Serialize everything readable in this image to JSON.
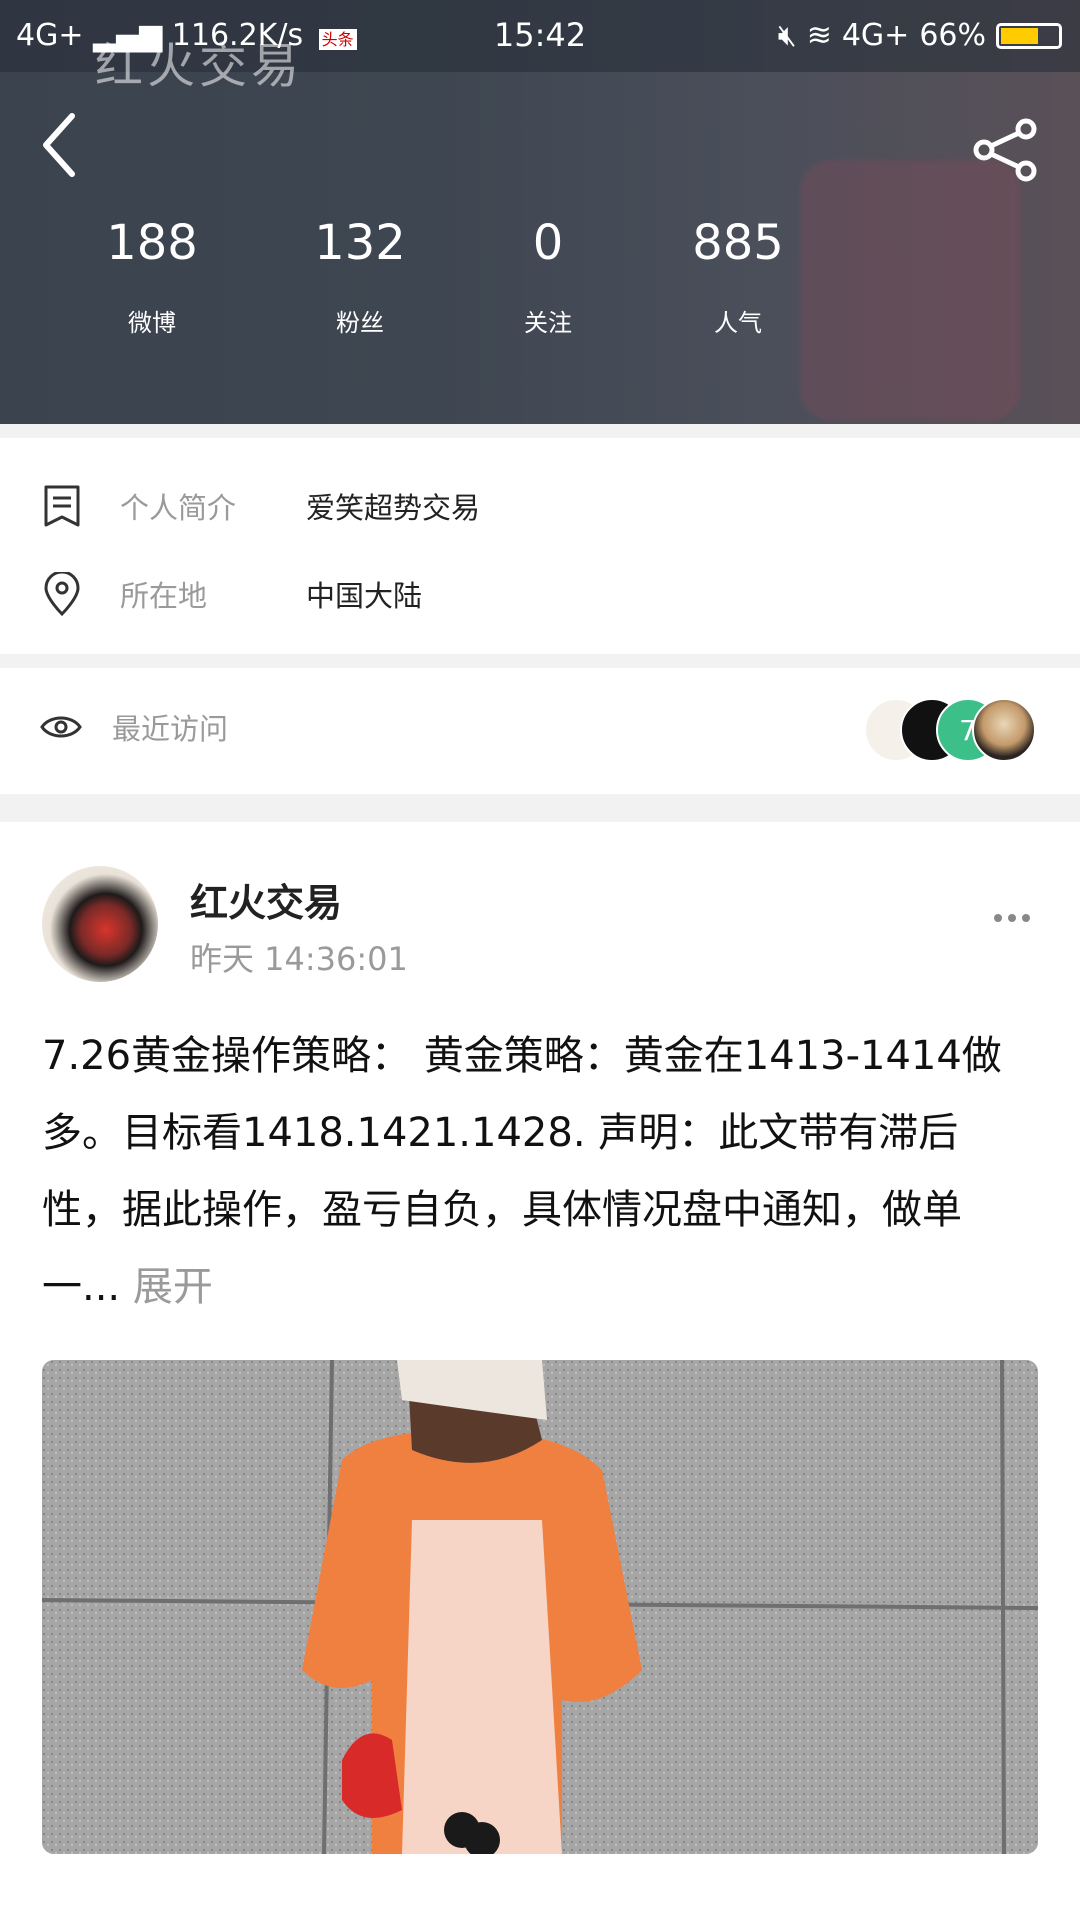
{
  "status_bar": {
    "network_left": "4G+",
    "speed": "116.2K/s",
    "app_badge": "头条",
    "time": "15:42",
    "network_right": "4G+",
    "battery": "66%",
    "battery_level": 0.66
  },
  "watermark": "红火交易",
  "stats": [
    {
      "value": "188",
      "label": "微博"
    },
    {
      "value": "132",
      "label": "粉丝"
    },
    {
      "value": "0",
      "label": "关注"
    },
    {
      "value": "885",
      "label": "人气"
    }
  ],
  "profile": {
    "bio_label": "个人简介",
    "bio_value": "爱笑超势交易",
    "location_label": "所在地",
    "location_value": "中国大陆"
  },
  "visitors": {
    "label": "最近访问",
    "avatar_initial": "7"
  },
  "post": {
    "author": "红火交易",
    "time": "昨天 14:36:01",
    "text": "7.26黄金操作策略： 黄金策略：黄金在1413-1414做多。目标看1418.1421.1428. 声明：此文带有滞后性，据此操作，盈亏自负，具体情况盘中通知，做单一...",
    "expand": "展开"
  },
  "icons": {
    "back": "chevron-left-icon",
    "share": "share-icon",
    "bio": "document-icon",
    "location": "location-pin-icon",
    "visitors": "eye-icon",
    "more": "more-dots-icon"
  },
  "colors": {
    "header": "#3e4651",
    "battery_fill": "#ffcc00",
    "muted_text": "#9a9a9a",
    "visitor_green": "#3cbf88"
  }
}
